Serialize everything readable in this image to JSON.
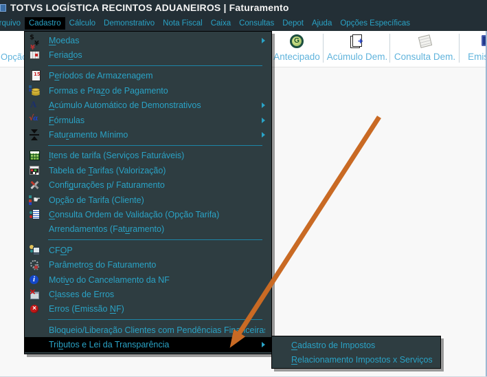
{
  "window": {
    "title_main": "TOTVS LOGÍSTICA RECINTOS ADUANEIROS",
    "title_separator": "|",
    "title_sub": "Faturamento"
  },
  "menubar": {
    "items": [
      {
        "label": "Arquivo",
        "clipped": true
      },
      {
        "label": "Cadastro",
        "highlighted": true
      },
      {
        "label": "Cálculo"
      },
      {
        "label": "Demonstrativo"
      },
      {
        "label": "Nota Fiscal"
      },
      {
        "label": "Caixa"
      },
      {
        "label": "Consultas"
      },
      {
        "label": "Depot"
      },
      {
        "label": "Ajuda"
      },
      {
        "label": "Opções Específicas"
      }
    ]
  },
  "toolbar": {
    "left_button": {
      "label": "Opção"
    },
    "buttons": [
      {
        "label": "Antecipado",
        "icon": "antecipado-icon"
      },
      {
        "label": "Acúmulo Dem.",
        "icon": "document-plus-icon"
      },
      {
        "label": "Consulta Dem.",
        "icon": "notes-icon"
      },
      {
        "label": "Emissão",
        "icon": "emission-icon",
        "clipped": true
      }
    ]
  },
  "cadastro_menu": {
    "items": [
      {
        "pre": "",
        "key": "M",
        "post": "oedas",
        "icon": "currency-icon",
        "submenu": true
      },
      {
        "pre": "Feria",
        "key": "d",
        "post": "os",
        "icon": "calendar-icon",
        "separator_after": true
      },
      {
        "pre": "P",
        "key": "e",
        "post": "ríodos de Armazenagem",
        "icon": "calendar-period-icon"
      },
      {
        "pre": "Formas e Pra",
        "key": "z",
        "post": "o de Pagamento",
        "icon": "coins-icon"
      },
      {
        "pre": "",
        "key": "A",
        "post": "cúmulo Automático de Demonstrativos",
        "icon": "letter-a-icon",
        "submenu": true
      },
      {
        "pre": "",
        "key": "F",
        "post": "órmulas",
        "icon": "formula-icon",
        "submenu": true
      },
      {
        "pre": "Fatu",
        "key": "r",
        "post": "amento Mínimo",
        "icon": "compress-icon",
        "submenu": true,
        "separator_after": true
      },
      {
        "pre": "",
        "key": "I",
        "post": "tens de tarifa (Serviços Faturáveis)",
        "icon": "grid-table-icon"
      },
      {
        "pre": "Tabela de ",
        "key": "T",
        "post": "arifas (Valorização)",
        "icon": "tariff-table-icon"
      },
      {
        "pre": "Confi",
        "key": "g",
        "post": "urações p/ Faturamento",
        "icon": "tools-icon"
      },
      {
        "pre": "Op",
        "key": "ç",
        "post": "ão de Tarifa (Cliente)",
        "icon": "pointing-hand-icon"
      },
      {
        "pre": "",
        "key": "C",
        "post": "onsulta Ordem de Validação (Opção Tarifa)",
        "icon": "document-search-icon"
      },
      {
        "pre": "Arrendamentos (Fat",
        "key": "u",
        "post": "ramento)",
        "icon": null,
        "separator_after": true
      },
      {
        "pre": "CF",
        "key": "O",
        "post": "P",
        "icon": "user-computer-icon"
      },
      {
        "pre": "Parâmetro",
        "key": "s",
        "post": " do Faturamento",
        "icon": "gears-icon"
      },
      {
        "pre": "Moti",
        "key": "v",
        "post": "o do Cancelamento da NF",
        "icon": "info-icon"
      },
      {
        "pre": "C",
        "key": "l",
        "post": "asses de Erros",
        "icon": "error-class-icon"
      },
      {
        "pre": "Erros (Emissão ",
        "key": "N",
        "post": "F)",
        "icon": "error-circle-icon",
        "separator_after": true
      },
      {
        "pre": "Bloqueio/Liberação Clientes com Pendências Financeiras",
        "key": "",
        "post": "",
        "icon": null
      },
      {
        "pre": "Tri",
        "key": "b",
        "post": "utos e Lei da Transparência",
        "icon": null,
        "submenu": true,
        "highlighted": true
      }
    ]
  },
  "tributos_submenu": {
    "items": [
      {
        "pre": "",
        "key": "C",
        "post": "adastro de Impostos"
      },
      {
        "pre": "",
        "key": "R",
        "post": "elacionamento Impostos x Serviços"
      }
    ]
  },
  "annotation": {
    "arrow_color": "#c96a24"
  },
  "colors": {
    "titlebar_bg": "#232f36",
    "menu_panel_bg": "#2e3d41",
    "accent_text": "#2aa3c6",
    "highlight_bg": "#000000",
    "toolbar_text": "#5fb3dc",
    "separator": "#1d86a8"
  }
}
